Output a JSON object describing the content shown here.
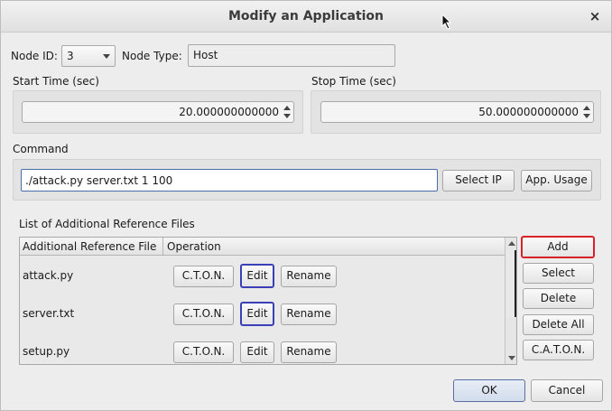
{
  "window": {
    "title": "Modify an Application",
    "close_icon": "×"
  },
  "node": {
    "id_label": "Node ID:",
    "id_value": "3",
    "type_label": "Node Type:",
    "type_value": "Host"
  },
  "times": {
    "start_label": "Start Time (sec)",
    "start_value": "20.000000000000",
    "stop_label": "Stop Time (sec)",
    "stop_value": "50.000000000000"
  },
  "command": {
    "label": "Command",
    "value": "./attack.py server.txt 1 100",
    "select_ip_label": "Select IP",
    "app_usage_label": "App. Usage"
  },
  "ref_files": {
    "title": "List of Additional Reference Files",
    "columns": [
      "Additional Reference File",
      "Operation"
    ],
    "rows": [
      {
        "file": "attack.py",
        "cton": "C.T.O.N.",
        "edit": "Edit",
        "rename": "Rename"
      },
      {
        "file": "server.txt",
        "cton": "C.T.O.N.",
        "edit": "Edit",
        "rename": "Rename"
      },
      {
        "file": "setup.py",
        "cton": "C.T.O.N.",
        "edit": "Edit",
        "rename": "Rename"
      }
    ]
  },
  "side_buttons": {
    "add": "Add",
    "select": "Select",
    "delete": "Delete",
    "delete_all": "Delete All",
    "caton": "C.A.T.O.N."
  },
  "footer": {
    "ok": "OK",
    "cancel": "Cancel"
  },
  "colors": {
    "highlight_blue": "#3b41b5",
    "highlight_red": "#d8222a",
    "input_border": "#4a6ea8"
  }
}
